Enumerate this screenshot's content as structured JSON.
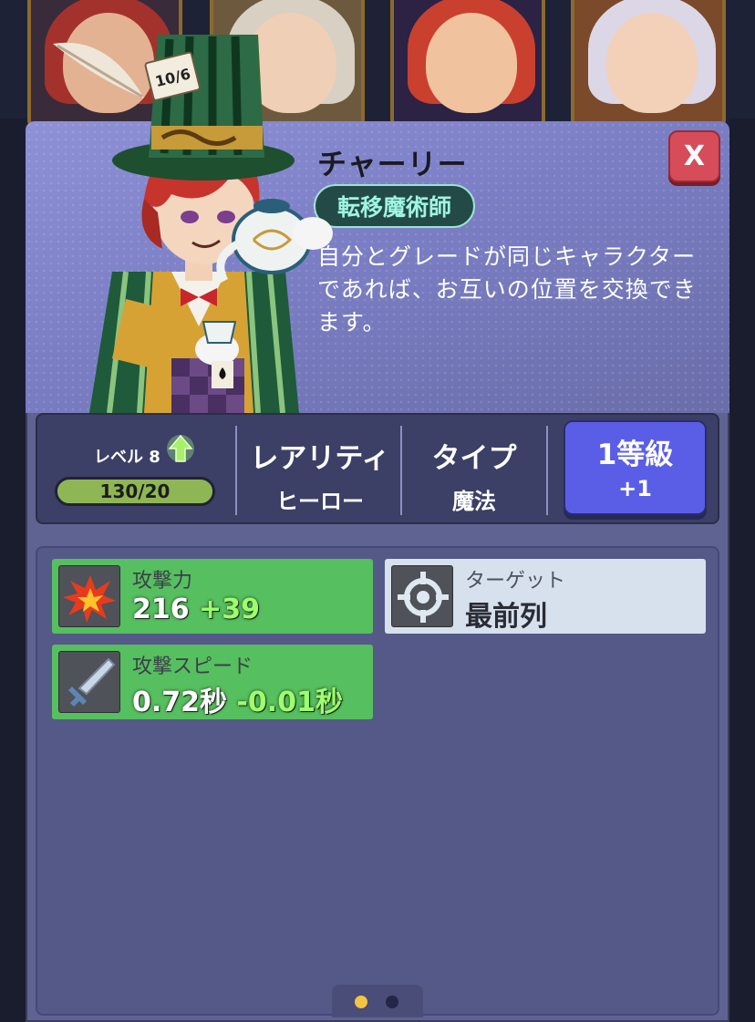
{
  "background": {
    "cards": [
      {
        "name": "card-1"
      },
      {
        "name": "card-2"
      },
      {
        "name": "card-3"
      },
      {
        "name": "card-4"
      }
    ]
  },
  "character": {
    "name": "チャーリー",
    "class": "転移魔術師",
    "description": "自分とグレードが同じキャラクターであれば、お互いの位置を交換できます。",
    "hat_card": "10/6"
  },
  "close_label": "X",
  "stats": {
    "level_label": "レベル 8",
    "xp": "130/20",
    "rarity_label": "レアリティ",
    "rarity_value": "ヒーロー",
    "type_label": "タイプ",
    "type_value": "魔法",
    "grade_label": "1等級",
    "grade_bonus": "+1"
  },
  "attributes": [
    {
      "label": "攻撃力",
      "value": "216",
      "bonus": "+39",
      "icon": "explosion-icon"
    },
    {
      "label": "ターゲット",
      "value": "最前列",
      "bonus": "",
      "icon": "crosshair-icon"
    },
    {
      "label": "攻撃スピード",
      "value": "0.72秒",
      "bonus": "-0.01秒",
      "icon": "sword-icon"
    }
  ],
  "pager": {
    "pages": 2,
    "active": 1
  },
  "colors": {
    "accent_green": "#56bf5f",
    "bonus_green": "#9dff6a",
    "grade_blue": "#5a5ee6",
    "close_red": "#d64c59",
    "active_dot": "#f4c542",
    "inactive_dot": "#23254a"
  }
}
